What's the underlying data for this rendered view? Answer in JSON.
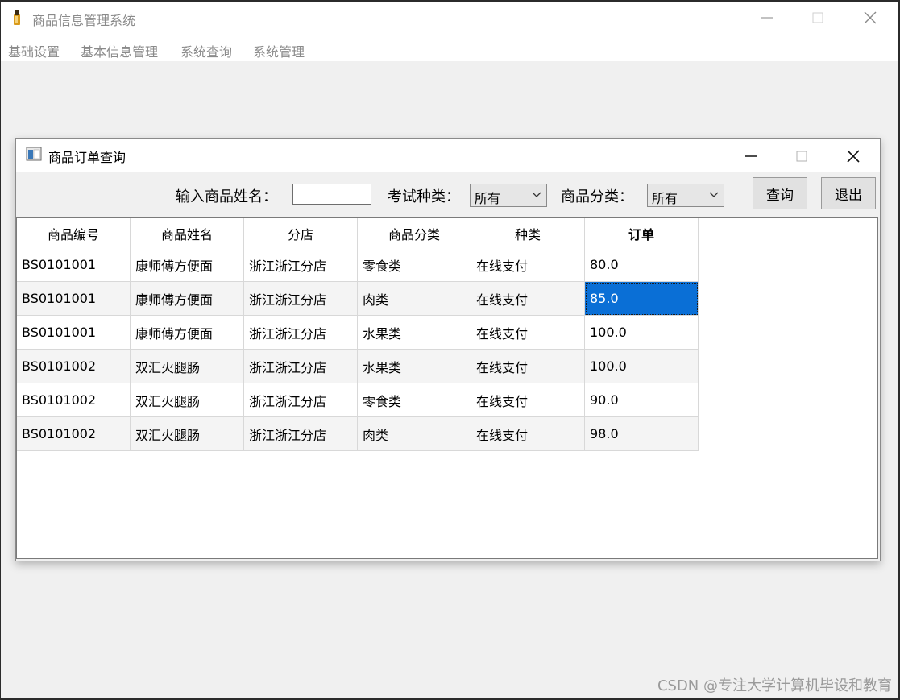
{
  "main_window": {
    "title": "商品信息管理系统",
    "menu": [
      "基础设置",
      "基本信息管理",
      "系统查询",
      "系统管理"
    ]
  },
  "dialog": {
    "title": "商品订单查询",
    "toolbar": {
      "name_label": "输入商品姓名：",
      "name_value": "",
      "type_label": "考试种类：",
      "type_selected": "所有",
      "category_label": "商品分类：",
      "category_selected": "所有",
      "query_button": "查询",
      "exit_button": "退出"
    },
    "table": {
      "columns": [
        "商品编号",
        "商品姓名",
        "分店",
        "商品分类",
        "种类",
        "订单"
      ],
      "rows": [
        [
          "BS0101001",
          "康师傅方便面",
          "浙江浙江分店",
          "零食类",
          "在线支付",
          "80.0"
        ],
        [
          "BS0101001",
          "康师傅方便面",
          "浙江浙江分店",
          "肉类",
          "在线支付",
          "85.0"
        ],
        [
          "BS0101001",
          "康师傅方便面",
          "浙江浙江分店",
          "水果类",
          "在线支付",
          "100.0"
        ],
        [
          "BS0101002",
          "双汇火腿肠",
          "浙江浙江分店",
          "水果类",
          "在线支付",
          "100.0"
        ],
        [
          "BS0101002",
          "双汇火腿肠",
          "浙江浙江分店",
          "零食类",
          "在线支付",
          "90.0"
        ],
        [
          "BS0101002",
          "双汇火腿肠",
          "浙江浙江分店",
          "肉类",
          "在线支付",
          "98.0"
        ]
      ],
      "selected_cell": "85.0"
    }
  },
  "watermark": "CSDN @专注大学计算机毕设和教育",
  "colors": {
    "selection": "#0a6fd6",
    "menu_text": "#8a8a8a"
  }
}
